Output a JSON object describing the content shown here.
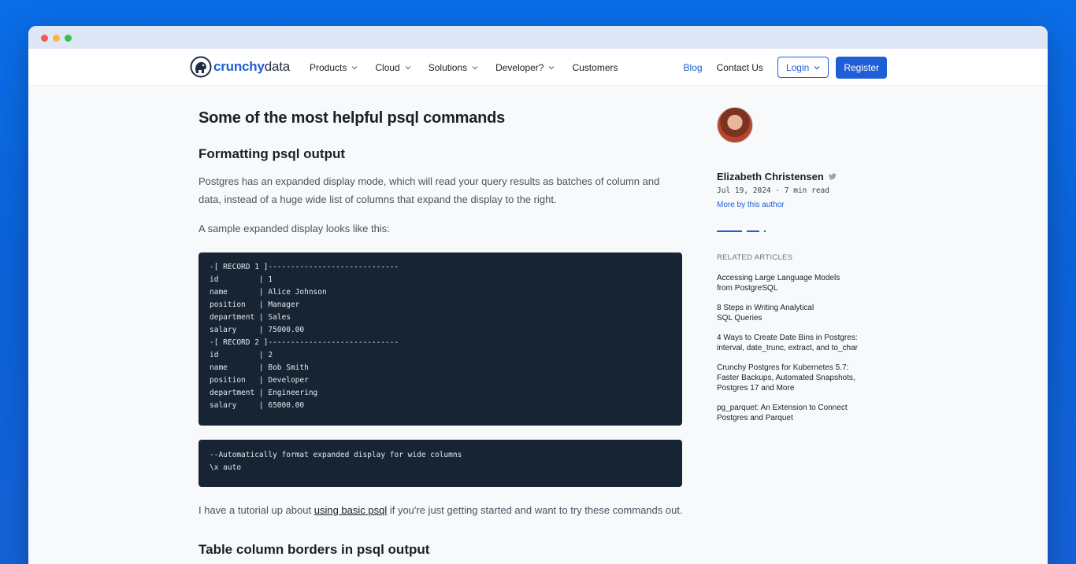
{
  "nav": {
    "logo_part1": "crunchy",
    "logo_part2": "data",
    "items": [
      {
        "label": "Products",
        "has_dropdown": true
      },
      {
        "label": "Cloud",
        "has_dropdown": true
      },
      {
        "label": "Solutions",
        "has_dropdown": true
      },
      {
        "label": "Developer?",
        "has_dropdown": true
      },
      {
        "label": "Customers",
        "has_dropdown": false
      }
    ],
    "blog": "Blog",
    "contact": "Contact Us",
    "login": "Login",
    "register": "Register"
  },
  "article": {
    "title": "Some of the most helpful psql commands",
    "section1_heading": "Formatting psql output",
    "paragraph1": "Postgres has an expanded display mode, which will read your query results as batches of column and data, instead of a huge wide list of columns that expand the display to the right.",
    "paragraph2": "A sample expanded display looks like this:",
    "code_block1": [
      "-[ RECORD 1 ]-----------------------------",
      "id         | 1",
      "name       | Alice Johnson",
      "position   | Manager",
      "department | Sales",
      "salary     | 75000.00",
      "-[ RECORD 2 ]-----------------------------",
      "id         | 2",
      "name       | Bob Smith",
      "position   | Developer",
      "department | Engineering",
      "salary     | 65000.00"
    ],
    "code_block2": [
      "--Automatically format expanded display for wide columns",
      "\\x auto"
    ],
    "paragraph3_before": "I have a tutorial up about ",
    "paragraph3_link": "using basic psql",
    "paragraph3_after": " if you're just getting started and want to try these commands out.",
    "section2_heading": "Table column borders in psql output"
  },
  "sidebar": {
    "author_name": "Elizabeth Christensen",
    "meta": "Jul 19, 2024 · 7 min read",
    "more_by_author": "More by this author",
    "related_title": "RELATED ARTICLES",
    "related": [
      "Accessing Large Language Models from PostgreSQL",
      "8 Steps in Writing Analytical SQL Queries",
      "4 Ways to Create Date Bins in Postgres: interval, date_trunc, extract, and to_char",
      "Crunchy Postgres for Kubernetes 5.7: Faster Backups, Automated Snapshots, Postgres 17 and More",
      "pg_parquet: An Extension to Connect Postgres and Parquet"
    ]
  },
  "colors": {
    "accent": "#1f5fd6",
    "code_bg": "#172433",
    "background": "#0b63db"
  }
}
